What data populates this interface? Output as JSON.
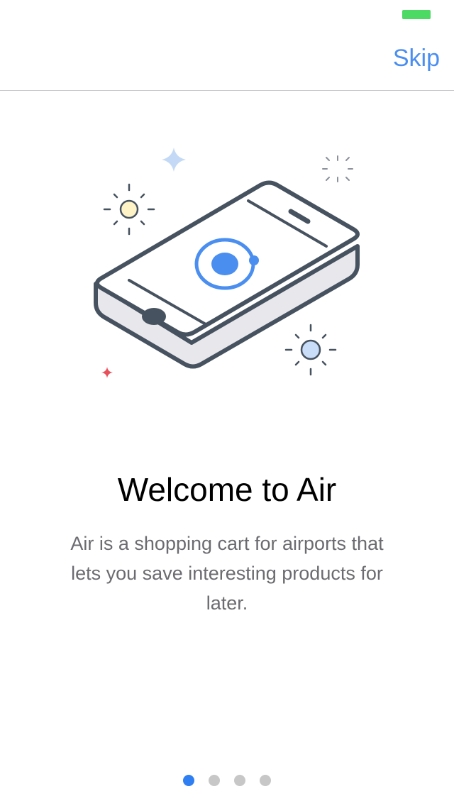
{
  "status_bar": {
    "battery_color": "#4cd964"
  },
  "nav": {
    "skip_label": "Skip",
    "accent_color": "#4a8ef0"
  },
  "illustration": {
    "icon": "phone-with-app-logo-illustration"
  },
  "content": {
    "title": "Welcome to Air",
    "description": "Air is a shopping cart for airports that lets you save interesting products for later."
  },
  "pager": {
    "total": 4,
    "active_index": 0,
    "active_color": "#2f7ff2",
    "inactive_color": "#c7c7c7"
  }
}
